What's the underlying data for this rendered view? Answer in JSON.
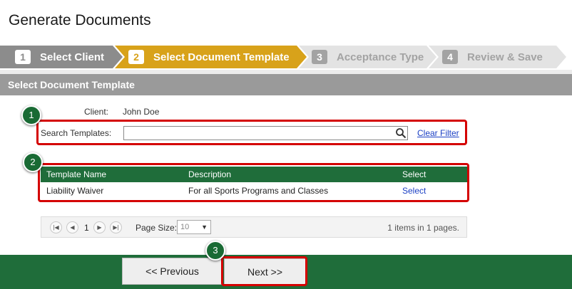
{
  "page": {
    "title": "Generate Documents"
  },
  "wizard": {
    "steps": [
      {
        "number": "1",
        "label": "Select Client",
        "state": "completed"
      },
      {
        "number": "2",
        "label": "Select Document Template",
        "state": "active"
      },
      {
        "number": "3",
        "label": "Acceptance Type",
        "state": "upcoming"
      },
      {
        "number": "4",
        "label": "Review & Save",
        "state": "upcoming"
      }
    ],
    "colors": {
      "completed": "#8c8c8c",
      "active": "#d8a21a",
      "upcoming": "#e3e3e3"
    }
  },
  "panel": {
    "header": "Select Document Template",
    "client_label": "Client:",
    "client_value": "John Doe",
    "search_label": "Search Templates:",
    "search_value": "",
    "search_icon": "search-icon",
    "clear_filter": "Clear Filter"
  },
  "grid": {
    "columns": [
      "Template Name",
      "Description",
      "Select"
    ],
    "rows": [
      {
        "name": "Liability Waiver",
        "description": "For all Sports Programs and Classes",
        "action": "Select"
      }
    ],
    "pager": {
      "first_icon": "first-page-icon",
      "prev_icon": "prev-page-icon",
      "next_icon": "next-page-icon",
      "last_icon": "last-page-icon",
      "current_page": "1",
      "page_size_label": "Page Size:",
      "page_size_value": "10",
      "info": "1 items in 1 pages."
    },
    "header_color": "#1f6d3a"
  },
  "annotations": {
    "markers": [
      "1",
      "2",
      "3"
    ],
    "highlight_color": "#d40000"
  },
  "footer": {
    "previous": "<< Previous",
    "next": "Next >>"
  }
}
